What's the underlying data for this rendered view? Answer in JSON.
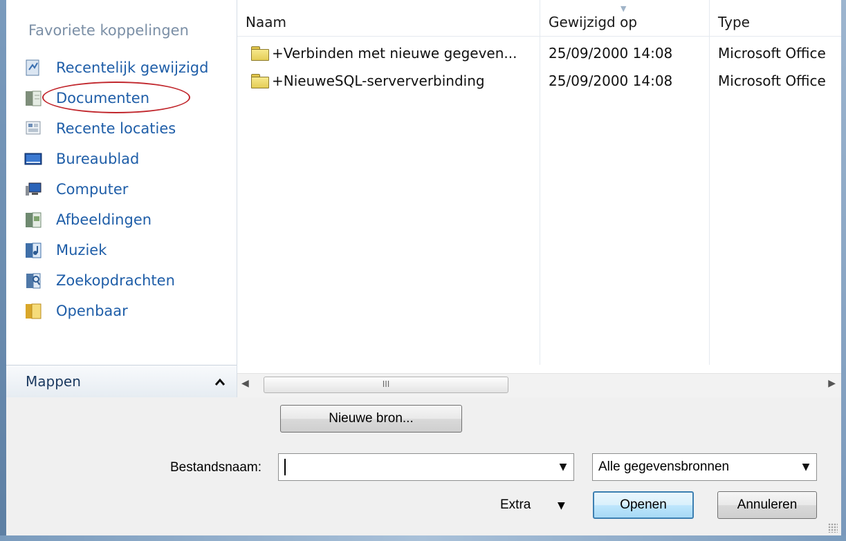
{
  "sidebar": {
    "heading": "Favoriete koppelingen",
    "items": [
      {
        "label": "Recentelijk gewijzigd",
        "icon": "recent-changes-icon"
      },
      {
        "label": "Documenten",
        "icon": "documents-icon",
        "highlighted": true
      },
      {
        "label": "Recente locaties",
        "icon": "recent-places-icon"
      },
      {
        "label": "Bureaublad",
        "icon": "desktop-icon"
      },
      {
        "label": "Computer",
        "icon": "computer-icon"
      },
      {
        "label": "Afbeeldingen",
        "icon": "pictures-icon"
      },
      {
        "label": "Muziek",
        "icon": "music-icon"
      },
      {
        "label": "Zoekopdrachten",
        "icon": "searches-icon"
      },
      {
        "label": "Openbaar",
        "icon": "public-folder-icon"
      }
    ],
    "folders_label": "Mappen",
    "folders_chevron": "^"
  },
  "file_list": {
    "columns": [
      "Naam",
      "Gewijzigd op",
      "Type"
    ],
    "rows": [
      {
        "name": "+Verbinden met nieuwe gegeven...",
        "modified": "25/09/2000 14:08",
        "type": "Microsoft Office"
      },
      {
        "name": "+NieuweSQL-serververbinding",
        "modified": "25/09/2000 14:08",
        "type": "Microsoft Office"
      }
    ],
    "scroll_thumb_glyph": "III"
  },
  "bottom": {
    "new_source_label": "Nieuwe bron...",
    "filename_label": "Bestandsnaam:",
    "filename_value": "",
    "filter_value": "Alle gegevensbronnen",
    "extra_label": "Extra",
    "open_label": "Openen",
    "cancel_label": "Annuleren"
  },
  "colors": {
    "link_blue": "#1f5ea8",
    "highlight_red": "#c1272d"
  }
}
